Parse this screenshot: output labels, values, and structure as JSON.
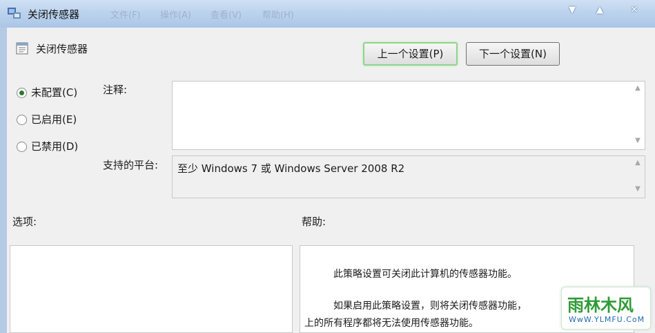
{
  "window": {
    "title": "关闭传感器",
    "faint_menus": [
      "文件(F)",
      "操作(A)",
      "查看(V)",
      "帮助(H)"
    ],
    "controls": [
      "▼",
      "▲",
      "✕"
    ]
  },
  "policy": {
    "name": "关闭传感器"
  },
  "nav": {
    "prev_label": "上一个设置(P)",
    "next_label": "下一个设置(N)"
  },
  "state": {
    "options": [
      {
        "label": "未配置(C)",
        "selected": true
      },
      {
        "label": "已启用(E)",
        "selected": false
      },
      {
        "label": "已禁用(D)",
        "selected": false
      }
    ]
  },
  "fields": {
    "comment_label": "注释:",
    "comment_value": "",
    "platform_label": "支持的平台:",
    "platform_value": "至少 Windows 7 或 Windows Server 2008 R2"
  },
  "sections": {
    "options_label": "选项:",
    "help_label": "帮助:"
  },
  "help": {
    "paragraph1": "此策略设置可关闭此计算机的传感器功能。",
    "paragraph2_line1": "如果启用此策略设置，则将关闭传感器功能，",
    "paragraph2_line2": "上的所有程序都将无法使用传感器功能。"
  },
  "watermark": {
    "main": "雨林木风",
    "sub": "WwW.YLMFU.CoM"
  }
}
